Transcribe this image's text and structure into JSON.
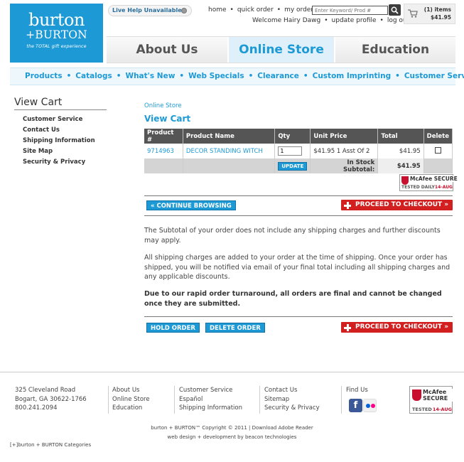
{
  "logo": {
    "line1": "burton",
    "line2": "+BURTON",
    "tagline": "the TOTAL gift experience"
  },
  "live_help": "Live Help Unavailable",
  "topnav": {
    "home": "home",
    "quick_order": "quick order",
    "my_orders": "my orders",
    "separator": "•"
  },
  "search": {
    "placeholder": "Enter Keyword/ Prod #"
  },
  "welcome": {
    "greeting": "Welcome Hairy Dawg",
    "update_profile": "update profile",
    "logout": "log out"
  },
  "cart_summary": {
    "items": "(1) items",
    "amount": "$41.95"
  },
  "tabs": {
    "about": "About Us",
    "online": "Online Store",
    "education": "Education"
  },
  "subnav": {
    "items": [
      "Products",
      "Catalogs",
      "What's New",
      "Web Specials",
      "Clearance",
      "Custom Imprinting",
      "Customer Service"
    ],
    "separator": "•"
  },
  "sidebar": {
    "title": "View Cart",
    "items": [
      "Customer Service",
      "Contact Us",
      "Shipping Information",
      "Site Map",
      "Security & Privacy"
    ]
  },
  "breadcrumb": "Online Store",
  "page_title": "View Cart",
  "table": {
    "headers": [
      "Product #",
      "Product Name",
      "Qty",
      "Unit Price",
      "Total",
      "Delete"
    ],
    "row": {
      "product_no": "9714963",
      "name": "DECOR STANDING WITCH",
      "qty": "1",
      "unit_price": "$41.95 1 Asst Of 2",
      "total": "$41.95"
    },
    "update_label": "UPDATE",
    "subtotal_label": "In Stock Subtotal:",
    "subtotal_value": "$41.95"
  },
  "mcafee": {
    "name": "McAfee SECURE",
    "tested": "TESTED DAILY",
    "tested_short": "TESTED",
    "date": "14-AUG"
  },
  "buttons": {
    "continue": "« CONTINUE BROWSING",
    "checkout": "PROCEED TO CHECKOUT »",
    "hold": "HOLD ORDER",
    "delete": "DELETE ORDER"
  },
  "paragraphs": {
    "p1": "The Subtotal of your order does not include any shipping charges and further discounts may apply.",
    "p2": "All shipping charges are added to your order at the time of shipping. Once your order has shipped, you will be notified via email of your final total including all shipping charges and any applicable discounts.",
    "p3": "Due to our rapid order turnaround, all orders are final and cannot be changed once they are submitted."
  },
  "footer": {
    "address": [
      "325 Cleveland Road",
      "Bogart, GA 30622-1766",
      "800.241.2094"
    ],
    "col2": [
      "About Us",
      "Online Store",
      "Education"
    ],
    "col3": [
      "Customer Service",
      "Español",
      "Shipping Information"
    ],
    "col4": [
      "Contact Us",
      "Sitemap",
      "Security & Privacy"
    ],
    "find_us": "Find Us",
    "facebook": "f",
    "copyright": "burton + BURTON™ Copyright © 2011 | Download Adobe Reader",
    "credits": "web design + development by beacon technologies",
    "categories": "[+]burton + BURTON Categories"
  },
  "colors": {
    "brand_blue": "#1d9ad6",
    "checkout_red": "#d21f1f",
    "header_gray": "#555555"
  },
  "icons": [
    "search-icon",
    "cart-icon",
    "mcafee-icon",
    "facebook-icon",
    "flickr-icon",
    "plus-icon"
  ]
}
